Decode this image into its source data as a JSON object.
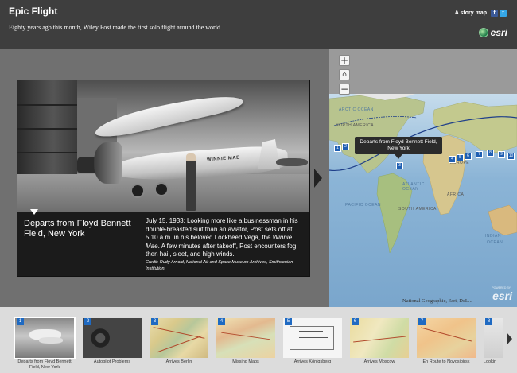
{
  "header": {
    "title": "Epic Flight",
    "subtitle": "Eighty years ago this month, Wiley Post made the first solo flight around the world.",
    "story_map_label": "A story map",
    "facebook_glyph": "f",
    "twitter_glyph": "t",
    "esri_logo_text": "esri"
  },
  "photo": {
    "plane_name": "WINNIE MAE"
  },
  "caption": {
    "title": "Departs from Floyd Bennett Field, New York",
    "text_before": "July 15, 1933: Looking more like a businessman in his double-breasted suit than an aviator, Post sets off at 5:10 a.m. in his beloved Lockheed Vega, the ",
    "text_em": "Winnie Mae",
    "text_after": ". A few minutes after takeoff, Post encounters fog, then hail, sleet, and high winds.",
    "credit": "Credit: Rudy Arnold, National Air and Space Museum Archives, Smithsonian Institution."
  },
  "map": {
    "zoom_in": "+",
    "zoom_home": "⌂",
    "zoom_out": "−",
    "tooltip": "Departs from Floyd Bennett Field, New York",
    "labels": {
      "arctic_ocean": "ARCTIC OCEAN",
      "pacific_ocean": "PACIFIC OCEAN",
      "atlantic_ocean": "ATLANTIC OCEAN",
      "north_america": "NORTH AMERICA",
      "south_america": "SOUTH AMERICA",
      "africa": "AFRICA",
      "europe": "EUROPE",
      "indian": "INDIAN",
      "ocean": "OCEAN"
    },
    "attribution": "National Geographic, Esri, DeL...",
    "watermark": "esri",
    "powered_by": "POWERED BY",
    "pins": [
      "1",
      "2",
      "3",
      "4",
      "5",
      "6",
      "7",
      "8",
      "9",
      "10"
    ],
    "route_color": "#1f5fb2"
  },
  "carousel": {
    "items": [
      {
        "num": "1",
        "label": "Departs from Floyd Bennett Field, New York"
      },
      {
        "num": "2",
        "label": "Autopilot Problems"
      },
      {
        "num": "3",
        "label": "Arrives Berlin"
      },
      {
        "num": "4",
        "label": "Missing Maps"
      },
      {
        "num": "5",
        "label": "Arrives Königsberg"
      },
      {
        "num": "6",
        "label": "Arrives Moscow"
      },
      {
        "num": "7",
        "label": "En Route to Novosibirsk"
      },
      {
        "num": "8",
        "label": "Lookin"
      }
    ]
  }
}
